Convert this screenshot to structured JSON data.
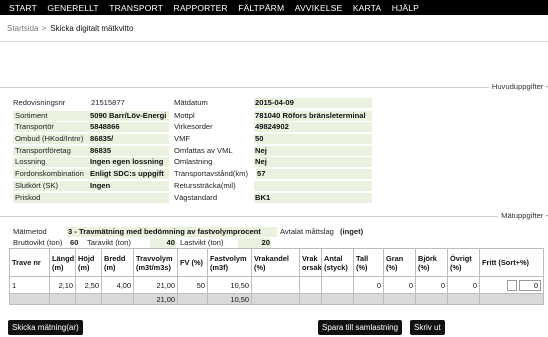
{
  "nav": {
    "items": [
      "START",
      "GENERELLT",
      "TRANSPORT",
      "RAPPORTER",
      "FÄLTPÄRM",
      "AVVIKELSE",
      "KARTA",
      "HJÄLP"
    ]
  },
  "breadcrumb": {
    "home": "Startsida",
    "separator": ">",
    "current": "Skicka digitalt mätkvitto"
  },
  "sections": {
    "main_legend": "Huvuduppgifter -",
    "measure_legend": "Mätuppgifter -"
  },
  "main": {
    "left": [
      {
        "label": "Redovisningsnr",
        "value": "21515877",
        "bold": false,
        "shaded": false
      },
      {
        "label": "Sortiment",
        "value": "5090 Barr/Löv-Energi",
        "bold": true,
        "shaded": true
      },
      {
        "label": "Transportör",
        "value": "5848866",
        "bold": true,
        "shaded": true
      },
      {
        "label": "Ombud (HKod/Intnr)",
        "value": "86835/",
        "bold": true,
        "shaded": true
      },
      {
        "label": "Transportföretag",
        "value": "86835",
        "bold": true,
        "shaded": true
      },
      {
        "label": "Lossning",
        "value": "Ingen egen lossning",
        "bold": true,
        "shaded": true
      },
      {
        "label": "Fordonskombination",
        "value": "Enligt SDC:s uppgift",
        "bold": true,
        "shaded": true
      },
      {
        "label": "Slutkört (SK)",
        "value": "Ingen",
        "bold": true,
        "shaded": true
      },
      {
        "label": "Priskod",
        "value": "",
        "bold": false,
        "shaded": true
      }
    ],
    "right": [
      {
        "label": "Mätdatum",
        "value": "2015-04-09"
      },
      {
        "label": "Mottpl",
        "value": "781040 Röfors bränsleterminal"
      },
      {
        "label": "Virkesorder",
        "value": "49824902"
      },
      {
        "label": "VMF",
        "value": "50"
      },
      {
        "label": "Omfattas av VML",
        "value": "Nej"
      },
      {
        "label": "Omlastning",
        "value": "Nej"
      },
      {
        "label": "Transportavstånd(km)",
        "value": "57"
      },
      {
        "label": "Returssträcka(mil)",
        "value": ""
      },
      {
        "label": "Vägstandard",
        "value": "BK1"
      }
    ]
  },
  "measure": {
    "method_label": "Mätmetod",
    "method_value": "3 - Travmätning med bedömning av fastvolymprocent",
    "agreed_label": "Avtalat måttslag",
    "agreed_value": "(inget)",
    "gross_label": "Bruttovikt (ton)",
    "gross_value": "60",
    "tare_label": "Taravikt (ton)",
    "tare_value": "40",
    "load_label": "Lastvikt (ton)",
    "load_value": "20"
  },
  "table": {
    "headers": [
      "Trave nr",
      "Längd (m)",
      "Höjd (m)",
      "Bredd (m)",
      "Travvolym (m3t/m3s)",
      "FV (%)",
      "Fastvolym (m3f)",
      "Vrakandel (%)",
      "Vrak orsak",
      "Antal (styck)",
      "Tall (%)",
      "Gran (%)",
      "Björk (%)",
      "Övrigt (%)",
      "Fritt (Sort+%)"
    ],
    "rows": [
      [
        "1",
        "2,10",
        "2,50",
        "4,00",
        "21,00",
        "50",
        "10,50",
        "",
        "",
        "",
        "0",
        "0",
        "0",
        "0",
        "0"
      ]
    ],
    "sum": [
      "",
      "",
      "",
      "",
      "21,00",
      "",
      "10,50",
      "",
      "",
      "",
      "",
      "",
      "",
      "",
      ""
    ]
  },
  "buttons": {
    "send": "Skicka mätning(ar)",
    "save": "Spara till samlastning",
    "print": "Skriv ut"
  }
}
